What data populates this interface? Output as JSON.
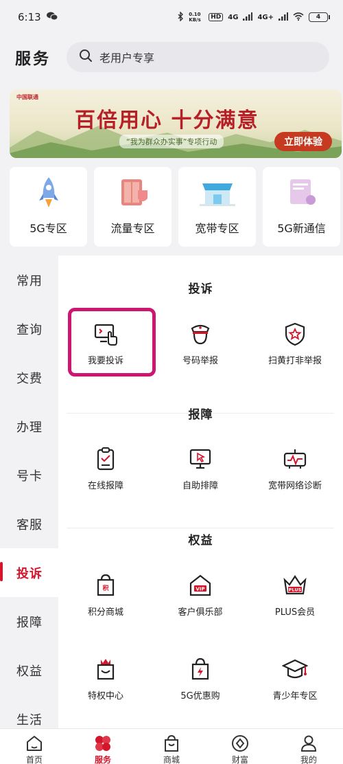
{
  "status_bar": {
    "time": "6:13",
    "speed": "0.10 KB/s",
    "network1": "4G",
    "network2": "4G+",
    "battery": "4"
  },
  "header": {
    "title": "服务",
    "search_placeholder": "老用户专享"
  },
  "banner": {
    "brand": "中国联通",
    "headline": "百倍用心 十分满意",
    "subtitle": "“我为群众办实事”专项行动",
    "cta": "立即体验"
  },
  "zones": [
    {
      "label": "5G专区",
      "icon": "rocket-icon"
    },
    {
      "label": "流量专区",
      "icon": "data-cabinet-icon"
    },
    {
      "label": "宽带专区",
      "icon": "store-icon"
    },
    {
      "label": "5G新通信",
      "icon": "screen-icon"
    }
  ],
  "sidebar": {
    "items": [
      {
        "label": "常用",
        "active": false
      },
      {
        "label": "查询",
        "active": false
      },
      {
        "label": "交费",
        "active": false
      },
      {
        "label": "办理",
        "active": false
      },
      {
        "label": "号卡",
        "active": false
      },
      {
        "label": "客服",
        "active": false
      },
      {
        "label": "投诉",
        "active": true
      },
      {
        "label": "报障",
        "active": false
      },
      {
        "label": "权益",
        "active": false
      },
      {
        "label": "生活",
        "active": false
      }
    ]
  },
  "sections": [
    {
      "title": "投诉",
      "items": [
        {
          "label": "我要投诉",
          "icon": "computer-click-icon"
        },
        {
          "label": "号码举报",
          "icon": "police-icon"
        },
        {
          "label": "扫黄打非举报",
          "icon": "shield-star-icon"
        }
      ]
    },
    {
      "title": "报障",
      "items": [
        {
          "label": "在线报障",
          "icon": "clipboard-icon"
        },
        {
          "label": "自助排障",
          "icon": "monitor-cursor-icon"
        },
        {
          "label": "宽带网络诊断",
          "icon": "router-pulse-icon"
        }
      ]
    },
    {
      "title": "权益",
      "items": [
        {
          "label": "积分商城",
          "icon": "points-bag-icon"
        },
        {
          "label": "客户俱乐部",
          "icon": "vip-house-icon"
        },
        {
          "label": "PLUS会员",
          "icon": "plus-crown-icon"
        }
      ]
    },
    {
      "title": "",
      "items": [
        {
          "label": "特权中心",
          "icon": "crown-bag-icon"
        },
        {
          "label": "5G优惠购",
          "icon": "shopping-bag-icon"
        },
        {
          "label": "青少年专区",
          "icon": "graduation-cap-icon"
        }
      ]
    }
  ],
  "bottom_nav": [
    {
      "label": "首页",
      "icon": "home-icon",
      "active": false
    },
    {
      "label": "服务",
      "icon": "clover-icon",
      "active": true
    },
    {
      "label": "商城",
      "icon": "shopping-bag-icon",
      "active": false
    },
    {
      "label": "财富",
      "icon": "coin-diamond-icon",
      "active": false
    },
    {
      "label": "我的",
      "icon": "person-icon",
      "active": false
    }
  ],
  "colors": {
    "accent": "#d4152a",
    "highlight": "#cc1670",
    "background": "#f2f2f4"
  }
}
